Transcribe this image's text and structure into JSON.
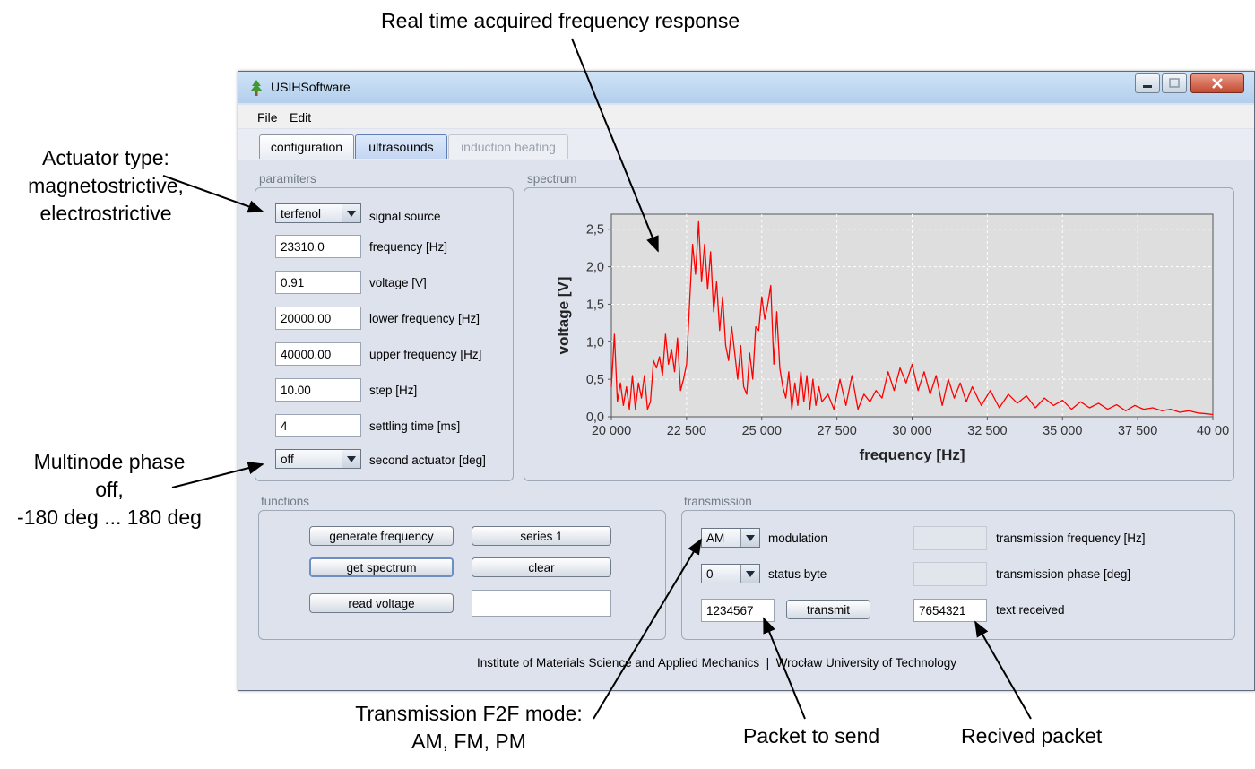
{
  "annotations": {
    "top": "Real time acquired frequency response",
    "actuator": [
      "Actuator type:",
      "magnetostrictive,",
      "electrostrictive"
    ],
    "multinode": [
      "Multinode phase",
      "off,",
      "-180 deg ... 180 deg"
    ],
    "transmission_mode": [
      "Transmission F2F mode:",
      "AM, FM, PM"
    ],
    "packet_send": "Packet to send",
    "packet_received": "Recived packet"
  },
  "window": {
    "title": "USIHSoftware",
    "icon": "tree-icon"
  },
  "menu": {
    "file": "File",
    "edit": "Edit"
  },
  "tabs": [
    {
      "label": "configuration",
      "state": "normal"
    },
    {
      "label": "ultrasounds",
      "state": "active"
    },
    {
      "label": "induction heating",
      "state": "disabled"
    }
  ],
  "parameters": {
    "title": "paramiters",
    "signal_source": {
      "value": "terfenol",
      "label": "signal source"
    },
    "frequency": {
      "value": "23310.0",
      "label": "frequency [Hz]"
    },
    "voltage": {
      "value": "0.91",
      "label": "voltage [V]"
    },
    "lower_frequency": {
      "value": "20000.00",
      "label": "lower frequency [Hz]"
    },
    "upper_frequency": {
      "value": "40000.00",
      "label": "upper frequency [Hz]"
    },
    "step": {
      "value": "10.00",
      "label": "step [Hz]"
    },
    "settling_time": {
      "value": "4",
      "label": "settling time [ms]"
    },
    "second_actuator": {
      "value": "off",
      "label": "second actuator [deg]"
    }
  },
  "spectrum": {
    "title": "spectrum"
  },
  "functions": {
    "title": "functions",
    "generate_frequency": "generate frequency",
    "series": "series 1",
    "get_spectrum": "get spectrum",
    "clear": "clear",
    "read_voltage": "read voltage",
    "voltage_readout": ""
  },
  "transmission": {
    "title": "transmission",
    "modulation": {
      "value": "AM",
      "label": "modulation"
    },
    "status_byte": {
      "value": "0",
      "label": "status byte"
    },
    "packet": "1234567",
    "transmit": "transmit",
    "transmission_frequency": {
      "value": "",
      "label": "transmission frequency [Hz]"
    },
    "transmission_phase": {
      "value": "",
      "label": "transmission phase [deg]"
    },
    "text_received": {
      "value": "7654321",
      "label": "text received"
    }
  },
  "footer": "Institute of Materials Science and Applied Mechanics  |  Wrocław University of Technology",
  "colors": {
    "trace": "#ff0000",
    "plot_bg": "#dedede",
    "window_bg": "#dde2ec"
  },
  "chart_data": {
    "type": "line",
    "xlabel": "frequency [Hz]",
    "ylabel": "voltage [V]",
    "xlim": [
      20000,
      40000
    ],
    "ylim": [
      0.0,
      2.7
    ],
    "x_ticks": [
      "20 000",
      "22 500",
      "25 000",
      "27 500",
      "30 000",
      "32 500",
      "35 000",
      "37 500",
      "40 00"
    ],
    "y_ticks": [
      "0,0",
      "0,5",
      "1,0",
      "1,5",
      "2,0",
      "2,5"
    ],
    "grid": true,
    "series": [
      {
        "color": "#ff0000",
        "x": [
          20000,
          20100,
          20200,
          20300,
          20400,
          20500,
          20600,
          20700,
          20800,
          20900,
          21000,
          21100,
          21200,
          21300,
          21400,
          21500,
          21600,
          21700,
          21800,
          21900,
          22000,
          22100,
          22200,
          22300,
          22400,
          22500,
          22600,
          22700,
          22800,
          22900,
          23000,
          23100,
          23200,
          23300,
          23400,
          23500,
          23600,
          23700,
          23800,
          23900,
          24000,
          24100,
          24200,
          24300,
          24400,
          24500,
          24600,
          24700,
          24800,
          24900,
          25000,
          25100,
          25200,
          25300,
          25400,
          25500,
          25600,
          25700,
          25800,
          25900,
          26000,
          26100,
          26200,
          26300,
          26400,
          26500,
          26600,
          26700,
          26800,
          26900,
          27000,
          27200,
          27400,
          27600,
          27800,
          28000,
          28200,
          28400,
          28600,
          28800,
          29000,
          29200,
          29400,
          29600,
          29800,
          30000,
          30200,
          30400,
          30600,
          30800,
          31000,
          31200,
          31400,
          31600,
          31800,
          32000,
          32300,
          32600,
          32900,
          33200,
          33500,
          33800,
          34100,
          34400,
          34700,
          35000,
          35300,
          35600,
          35900,
          36200,
          36500,
          36800,
          37100,
          37400,
          37700,
          38000,
          38300,
          38600,
          38900,
          39200,
          39500,
          39800,
          40000
        ],
        "y": [
          0.4,
          1.1,
          0.2,
          0.45,
          0.15,
          0.4,
          0.1,
          0.55,
          0.1,
          0.45,
          0.25,
          0.55,
          0.1,
          0.2,
          0.75,
          0.65,
          0.8,
          0.55,
          1.1,
          0.7,
          0.9,
          0.6,
          1.05,
          0.35,
          0.5,
          0.7,
          1.5,
          2.3,
          1.9,
          2.6,
          1.8,
          2.3,
          1.7,
          2.2,
          1.4,
          1.8,
          1.15,
          1.6,
          0.95,
          0.75,
          1.2,
          0.85,
          0.5,
          0.95,
          0.4,
          0.3,
          0.85,
          0.5,
          1.2,
          1.15,
          1.6,
          1.3,
          1.5,
          1.75,
          0.7,
          1.4,
          0.65,
          0.4,
          0.25,
          0.6,
          0.1,
          0.45,
          0.15,
          0.6,
          0.2,
          0.55,
          0.1,
          0.5,
          0.15,
          0.4,
          0.2,
          0.3,
          0.1,
          0.5,
          0.15,
          0.55,
          0.1,
          0.3,
          0.2,
          0.35,
          0.25,
          0.6,
          0.35,
          0.65,
          0.45,
          0.7,
          0.35,
          0.6,
          0.3,
          0.55,
          0.15,
          0.5,
          0.25,
          0.45,
          0.2,
          0.4,
          0.15,
          0.35,
          0.12,
          0.3,
          0.18,
          0.28,
          0.12,
          0.25,
          0.15,
          0.22,
          0.1,
          0.2,
          0.12,
          0.18,
          0.1,
          0.16,
          0.08,
          0.15,
          0.1,
          0.12,
          0.08,
          0.1,
          0.06,
          0.08,
          0.05,
          0.04,
          0.03
        ]
      }
    ]
  }
}
